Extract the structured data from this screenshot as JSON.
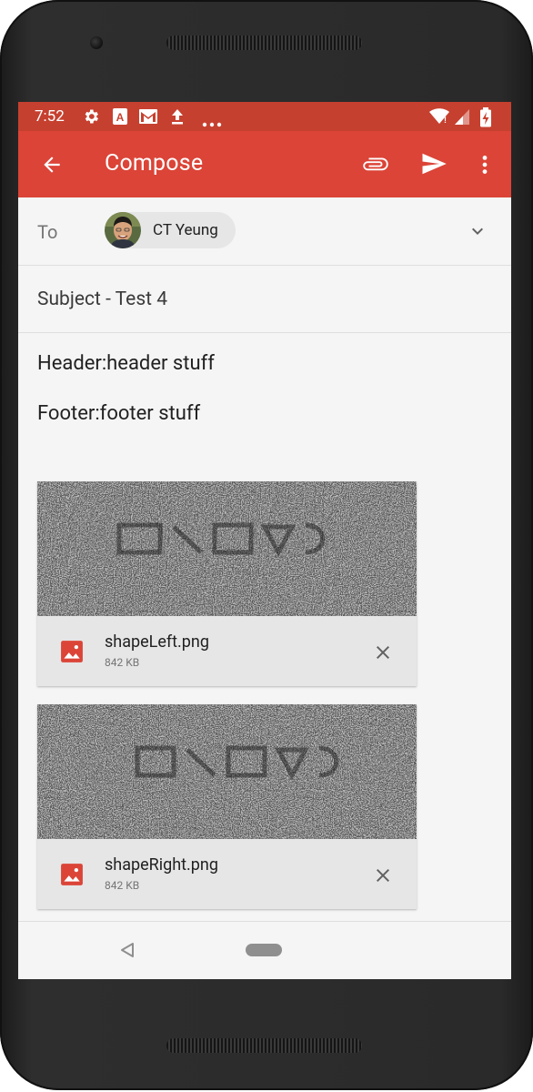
{
  "status_bar": {
    "time": "7:52",
    "icons": [
      "settings-icon",
      "app-a-icon",
      "gmail-icon",
      "upload-icon",
      "more-notifications-icon",
      "wifi-icon",
      "signal-icon",
      "battery-charging-icon"
    ]
  },
  "app_bar": {
    "title": "Compose",
    "back_icon": "arrow-back-icon",
    "actions": [
      "attach-icon",
      "send-icon",
      "more-vert-icon"
    ],
    "color": "#db4437",
    "status_color": "#c6402f"
  },
  "to": {
    "label": "To",
    "recipient": "CT Yeung"
  },
  "subject": "Subject - Test 4",
  "body_lines": [
    "Header:header stuff",
    "Footer:footer stuff"
  ],
  "attachments": [
    {
      "name": "shapeLeft.png",
      "size": "842 KB"
    },
    {
      "name": "shapeRight.png",
      "size": "842 KB"
    }
  ]
}
